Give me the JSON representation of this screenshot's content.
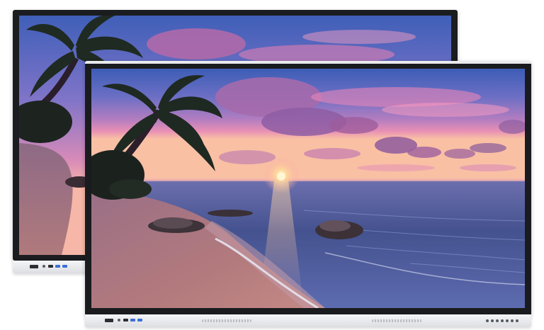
{
  "scene": {
    "subject": "interactive-flat-panel-display",
    "panel_count": 2,
    "wallpaper": "tropical-beach-sunset",
    "colors": {
      "sky_top": "#3f5fb8",
      "sky_mid": "#8a76c9",
      "sky_low": "#e58ab8",
      "horizon_glow": "#ffd8a8",
      "sun": "#fff2c4",
      "sea": "#3d4f8f",
      "sand": "#a8757f",
      "bezel": "#1b1c1f",
      "bottom_bar": "#e8e9ec",
      "accent_port": "#3b6fd8"
    }
  }
}
